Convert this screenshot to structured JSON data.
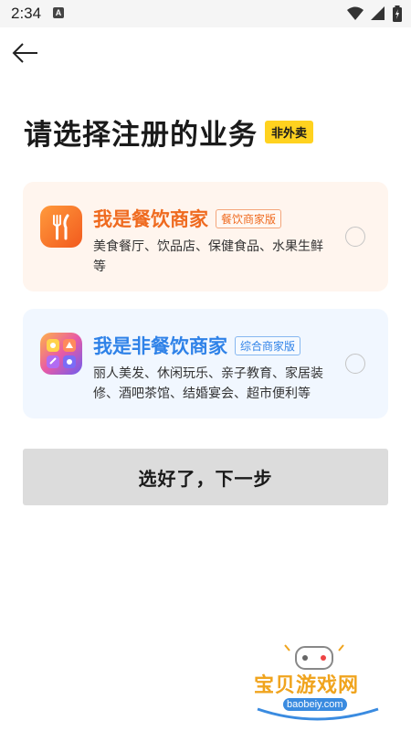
{
  "statusbar": {
    "time": "2:34",
    "notification_letter": "A"
  },
  "header": {
    "title": "请选择注册的业务",
    "tag": "非外卖"
  },
  "cards": [
    {
      "title": "我是餐饮商家",
      "badge": "餐饮商家版",
      "description": "美食餐厅、饮品店、保健食品、水果生鲜等",
      "icon": "utensils-icon",
      "accent": "#ef6a1f",
      "selected": false
    },
    {
      "title": "我是非餐饮商家",
      "badge": "综合商家版",
      "description": "丽人美发、休闲玩乐、亲子教育、家居装修、酒吧茶馆、结婚宴会、超市便利等",
      "icon": "multi-category-icon",
      "accent": "#2f82e8",
      "selected": false
    }
  ],
  "next_button": {
    "label": "选好了，下一步"
  },
  "watermark": {
    "name": "宝贝游戏网",
    "url": "baobeiy.com"
  }
}
